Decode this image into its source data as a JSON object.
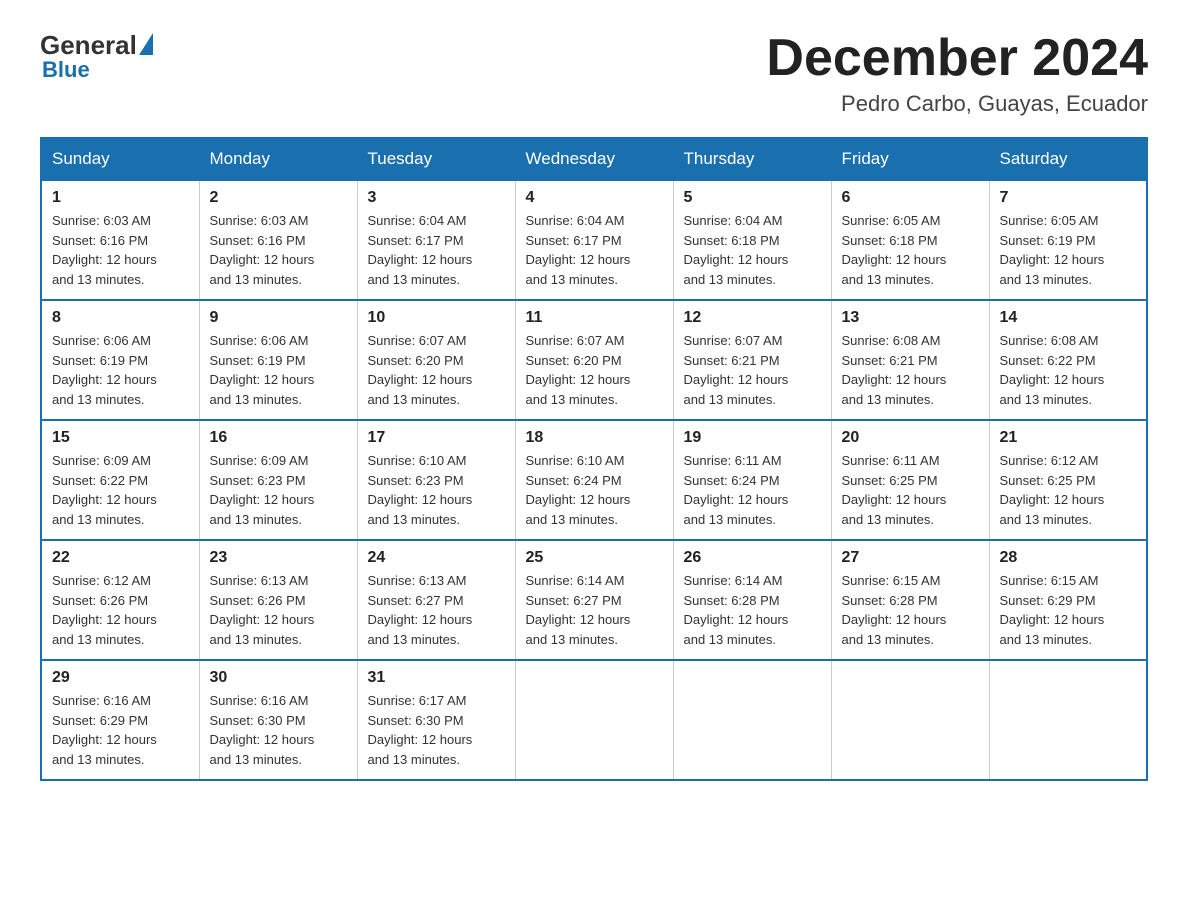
{
  "logo": {
    "general": "General",
    "triangle": "",
    "blue": "Blue"
  },
  "header": {
    "month": "December 2024",
    "location": "Pedro Carbo, Guayas, Ecuador"
  },
  "weekdays": [
    "Sunday",
    "Monday",
    "Tuesday",
    "Wednesday",
    "Thursday",
    "Friday",
    "Saturday"
  ],
  "weeks": [
    [
      {
        "day": "1",
        "sunrise": "6:03 AM",
        "sunset": "6:16 PM",
        "daylight": "12 hours and 13 minutes."
      },
      {
        "day": "2",
        "sunrise": "6:03 AM",
        "sunset": "6:16 PM",
        "daylight": "12 hours and 13 minutes."
      },
      {
        "day": "3",
        "sunrise": "6:04 AM",
        "sunset": "6:17 PM",
        "daylight": "12 hours and 13 minutes."
      },
      {
        "day": "4",
        "sunrise": "6:04 AM",
        "sunset": "6:17 PM",
        "daylight": "12 hours and 13 minutes."
      },
      {
        "day": "5",
        "sunrise": "6:04 AM",
        "sunset": "6:18 PM",
        "daylight": "12 hours and 13 minutes."
      },
      {
        "day": "6",
        "sunrise": "6:05 AM",
        "sunset": "6:18 PM",
        "daylight": "12 hours and 13 minutes."
      },
      {
        "day": "7",
        "sunrise": "6:05 AM",
        "sunset": "6:19 PM",
        "daylight": "12 hours and 13 minutes."
      }
    ],
    [
      {
        "day": "8",
        "sunrise": "6:06 AM",
        "sunset": "6:19 PM",
        "daylight": "12 hours and 13 minutes."
      },
      {
        "day": "9",
        "sunrise": "6:06 AM",
        "sunset": "6:19 PM",
        "daylight": "12 hours and 13 minutes."
      },
      {
        "day": "10",
        "sunrise": "6:07 AM",
        "sunset": "6:20 PM",
        "daylight": "12 hours and 13 minutes."
      },
      {
        "day": "11",
        "sunrise": "6:07 AM",
        "sunset": "6:20 PM",
        "daylight": "12 hours and 13 minutes."
      },
      {
        "day": "12",
        "sunrise": "6:07 AM",
        "sunset": "6:21 PM",
        "daylight": "12 hours and 13 minutes."
      },
      {
        "day": "13",
        "sunrise": "6:08 AM",
        "sunset": "6:21 PM",
        "daylight": "12 hours and 13 minutes."
      },
      {
        "day": "14",
        "sunrise": "6:08 AM",
        "sunset": "6:22 PM",
        "daylight": "12 hours and 13 minutes."
      }
    ],
    [
      {
        "day": "15",
        "sunrise": "6:09 AM",
        "sunset": "6:22 PM",
        "daylight": "12 hours and 13 minutes."
      },
      {
        "day": "16",
        "sunrise": "6:09 AM",
        "sunset": "6:23 PM",
        "daylight": "12 hours and 13 minutes."
      },
      {
        "day": "17",
        "sunrise": "6:10 AM",
        "sunset": "6:23 PM",
        "daylight": "12 hours and 13 minutes."
      },
      {
        "day": "18",
        "sunrise": "6:10 AM",
        "sunset": "6:24 PM",
        "daylight": "12 hours and 13 minutes."
      },
      {
        "day": "19",
        "sunrise": "6:11 AM",
        "sunset": "6:24 PM",
        "daylight": "12 hours and 13 minutes."
      },
      {
        "day": "20",
        "sunrise": "6:11 AM",
        "sunset": "6:25 PM",
        "daylight": "12 hours and 13 minutes."
      },
      {
        "day": "21",
        "sunrise": "6:12 AM",
        "sunset": "6:25 PM",
        "daylight": "12 hours and 13 minutes."
      }
    ],
    [
      {
        "day": "22",
        "sunrise": "6:12 AM",
        "sunset": "6:26 PM",
        "daylight": "12 hours and 13 minutes."
      },
      {
        "day": "23",
        "sunrise": "6:13 AM",
        "sunset": "6:26 PM",
        "daylight": "12 hours and 13 minutes."
      },
      {
        "day": "24",
        "sunrise": "6:13 AM",
        "sunset": "6:27 PM",
        "daylight": "12 hours and 13 minutes."
      },
      {
        "day": "25",
        "sunrise": "6:14 AM",
        "sunset": "6:27 PM",
        "daylight": "12 hours and 13 minutes."
      },
      {
        "day": "26",
        "sunrise": "6:14 AM",
        "sunset": "6:28 PM",
        "daylight": "12 hours and 13 minutes."
      },
      {
        "day": "27",
        "sunrise": "6:15 AM",
        "sunset": "6:28 PM",
        "daylight": "12 hours and 13 minutes."
      },
      {
        "day": "28",
        "sunrise": "6:15 AM",
        "sunset": "6:29 PM",
        "daylight": "12 hours and 13 minutes."
      }
    ],
    [
      {
        "day": "29",
        "sunrise": "6:16 AM",
        "sunset": "6:29 PM",
        "daylight": "12 hours and 13 minutes."
      },
      {
        "day": "30",
        "sunrise": "6:16 AM",
        "sunset": "6:30 PM",
        "daylight": "12 hours and 13 minutes."
      },
      {
        "day": "31",
        "sunrise": "6:17 AM",
        "sunset": "6:30 PM",
        "daylight": "12 hours and 13 minutes."
      },
      null,
      null,
      null,
      null
    ]
  ]
}
